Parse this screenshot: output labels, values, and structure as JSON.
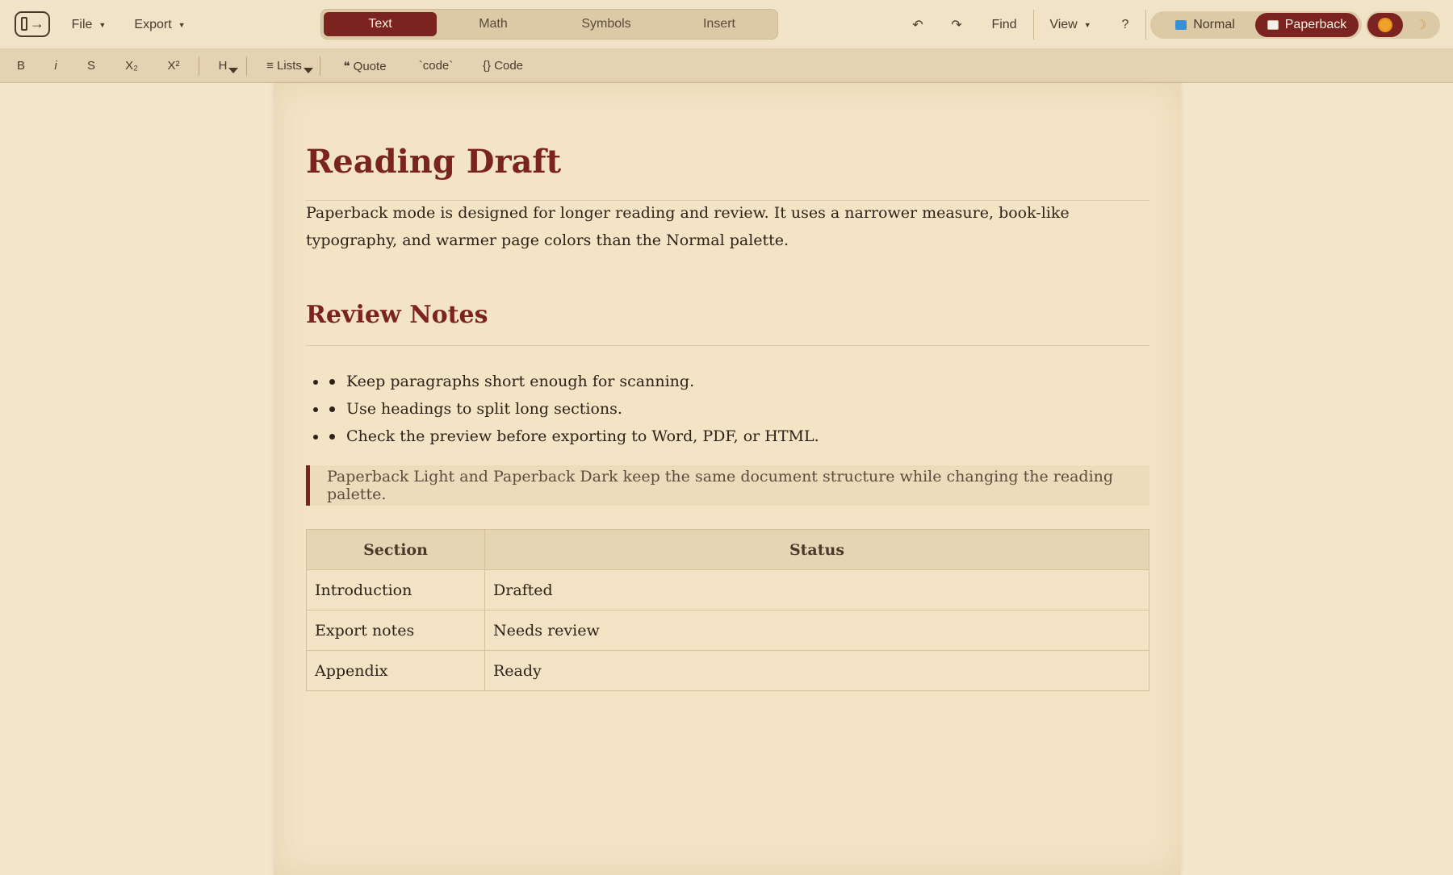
{
  "topbar": {
    "file_label": "File",
    "export_label": "Export",
    "mode_tabs": [
      "Text",
      "Math",
      "Symbols",
      "Insert"
    ],
    "active_mode": "Text",
    "undo_icon": "undo-icon",
    "redo_icon": "redo-icon",
    "undo_glyph": "↶",
    "redo_glyph": "↷",
    "find_label": "Find",
    "view_label": "View",
    "help_label": "?",
    "palette": {
      "normal_label": "Normal",
      "paperback_label": "Paperback",
      "active": "Paperback"
    },
    "theme": {
      "light_icon": "sun-icon",
      "dark_icon": "moon-icon",
      "dark_glyph": "☽",
      "active": "light"
    }
  },
  "formatbar": {
    "bold": "B",
    "italic": "i",
    "strike": "S",
    "subscript": "X₂",
    "superscript": "X²",
    "heading": "H",
    "lists": "≡ Lists",
    "quote": "❝ Quote",
    "inline_code": "`code`",
    "code_block": "{} Code"
  },
  "document": {
    "title": "Reading Draft",
    "intro": "Paperback mode is designed for longer reading and review. It uses a narrower measure, book-like typography, and warmer page colors than the Normal palette.",
    "section_heading": "Review Notes",
    "bullets": [
      "Keep paragraphs short enough for scanning.",
      "Use headings to split long sections.",
      "Check the preview before exporting to Word, PDF, or HTML."
    ],
    "quote": "Paperback Light and Paperback Dark keep the same document structure while changing the reading palette.",
    "table": {
      "headers": [
        "Section",
        "Status"
      ],
      "rows": [
        [
          "Introduction",
          "Drafted"
        ],
        [
          "Export notes",
          "Needs review"
        ],
        [
          "Appendix",
          "Ready"
        ]
      ]
    }
  },
  "colors": {
    "accent": "#7a2320",
    "page": "#f3e4c6",
    "toolbar": "#f1e3c8",
    "formatbar": "#e3d3b3"
  }
}
